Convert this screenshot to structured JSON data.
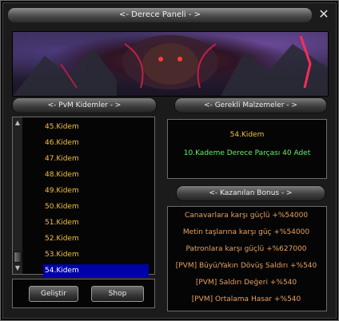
{
  "window": {
    "title": "<- Derece Paneli - >",
    "close_icon": "close-icon"
  },
  "sections": {
    "pvm_header": "<- PvM Kidemler - >",
    "materials_header": "<- Gerekli Malzemeler - >",
    "bonus_header": "<- Kazanılan Bonus - >"
  },
  "ranks": [
    "45.Kidem",
    "46.Kidem",
    "47.Kidem",
    "48.Kidem",
    "49.Kidem",
    "50.Kidem",
    "51.Kidem",
    "52.Kidem",
    "53.Kidem",
    "54.Kidem"
  ],
  "selected_rank": "54.Kidem",
  "materials": {
    "rank": "54.Kidem",
    "requirement": "10.Kademe Derece Parçası 40 Adet"
  },
  "bonuses": [
    "Canavarlara karşı güçlü +%54000",
    "Metin taşlarına karşı güç +%54000",
    "Patronlara karşı güçlü +%627000",
    "[PVM] Büyü/Yakın Dövüş Saldırı +%540",
    "[PVM] Saldırı Değeri +%540",
    "[PVM] Ortalama Hasar +%540"
  ],
  "buttons": {
    "improve": "Geliştir",
    "shop": "Shop"
  },
  "colors": {
    "rank_text": "#f0c040",
    "requirement_text": "#66ee66",
    "bonus_text": "#e8a060",
    "selection": "#0000aa"
  }
}
